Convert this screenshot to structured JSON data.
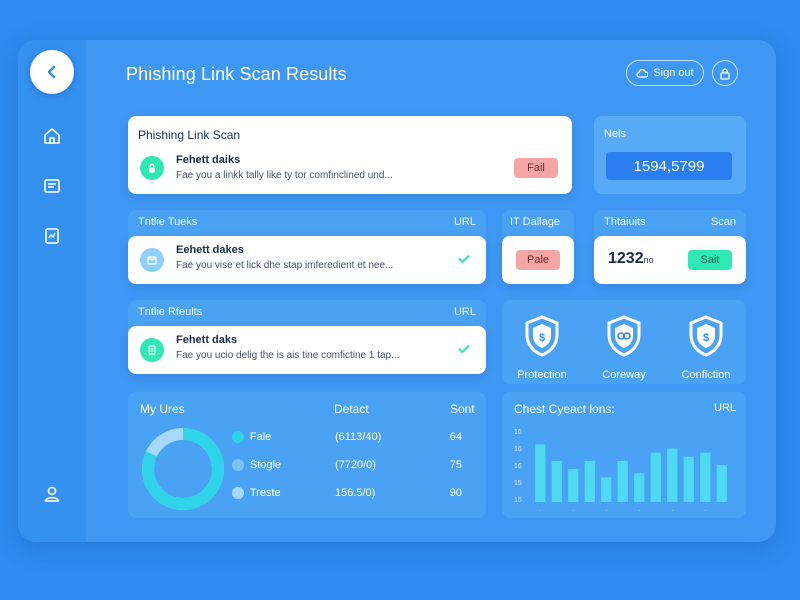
{
  "header": {
    "title": "Phishing Link Scan Results",
    "signout_label": "Sign out"
  },
  "sidebar": {
    "items": [
      {
        "icon": "home-icon"
      },
      {
        "icon": "inbox-icon"
      },
      {
        "icon": "report-icon"
      },
      {
        "icon": "user-icon"
      }
    ]
  },
  "scan_card": {
    "title": "Phishing Link Scan",
    "item_title": "Fehett daiks",
    "item_desc": "Fae you a linkk tally like ty tor comfinclined und...",
    "status": "Fail"
  },
  "stat_card": {
    "label": "Nels",
    "value": "1594,5799"
  },
  "tasks_panel": {
    "header_left": "Tntlie Tueks",
    "header_right": "URL",
    "item_title": "Eehett dakes",
    "item_desc": "Fae you vise et lick dhe stap imferedient et nee..."
  },
  "damage_card": {
    "header": "IT Dallage",
    "status": "Pale"
  },
  "threats_card": {
    "header_left": "Thtaiuits",
    "header_right": "Scan",
    "value": "1232",
    "unit": "no",
    "action": "Sait"
  },
  "results_panel": {
    "header_left": "Tntlie Rfeults",
    "header_right": "URL",
    "item_title": "Fehett daks",
    "item_desc": "Fae you ucio delig the is ais tine comfictine 1 tap..."
  },
  "shields": [
    {
      "label": "Protection",
      "icon": "shield-dollar-icon"
    },
    {
      "label": "Coreway",
      "icon": "shield-link-icon"
    },
    {
      "label": "Confiction",
      "icon": "shield-dollar-icon"
    }
  ],
  "summary": {
    "title": "My Ures",
    "col_detect": "Detact",
    "col_sort": "Sont",
    "rows": [
      {
        "name": "Fale",
        "detect": "(6113/40)",
        "count": "64",
        "color": "#2fd4e8"
      },
      {
        "name": "Stogle",
        "detect": "(7720/0)",
        "count": "75",
        "color": "#7fc4f6"
      },
      {
        "name": "Treste",
        "detect": "156.5/0)",
        "count": "90",
        "color": "#a8d9fb"
      }
    ]
  },
  "chart_data": {
    "type": "bar",
    "title": "Chest Cyeact lons:",
    "corner_label": "URL",
    "yticks": [
      "16",
      "16",
      "16",
      "15",
      "15"
    ],
    "values": [
      14,
      10,
      8,
      10,
      6,
      10,
      7,
      12,
      13,
      11,
      12,
      9
    ],
    "ylim": [
      0,
      18
    ],
    "bar_color": "#4fe0f0"
  },
  "colors": {
    "background": "#2f8cf0",
    "accent_teal": "#2ee8b6",
    "fail_red": "#f6a5a5",
    "value_blue": "#2a7ef0"
  }
}
